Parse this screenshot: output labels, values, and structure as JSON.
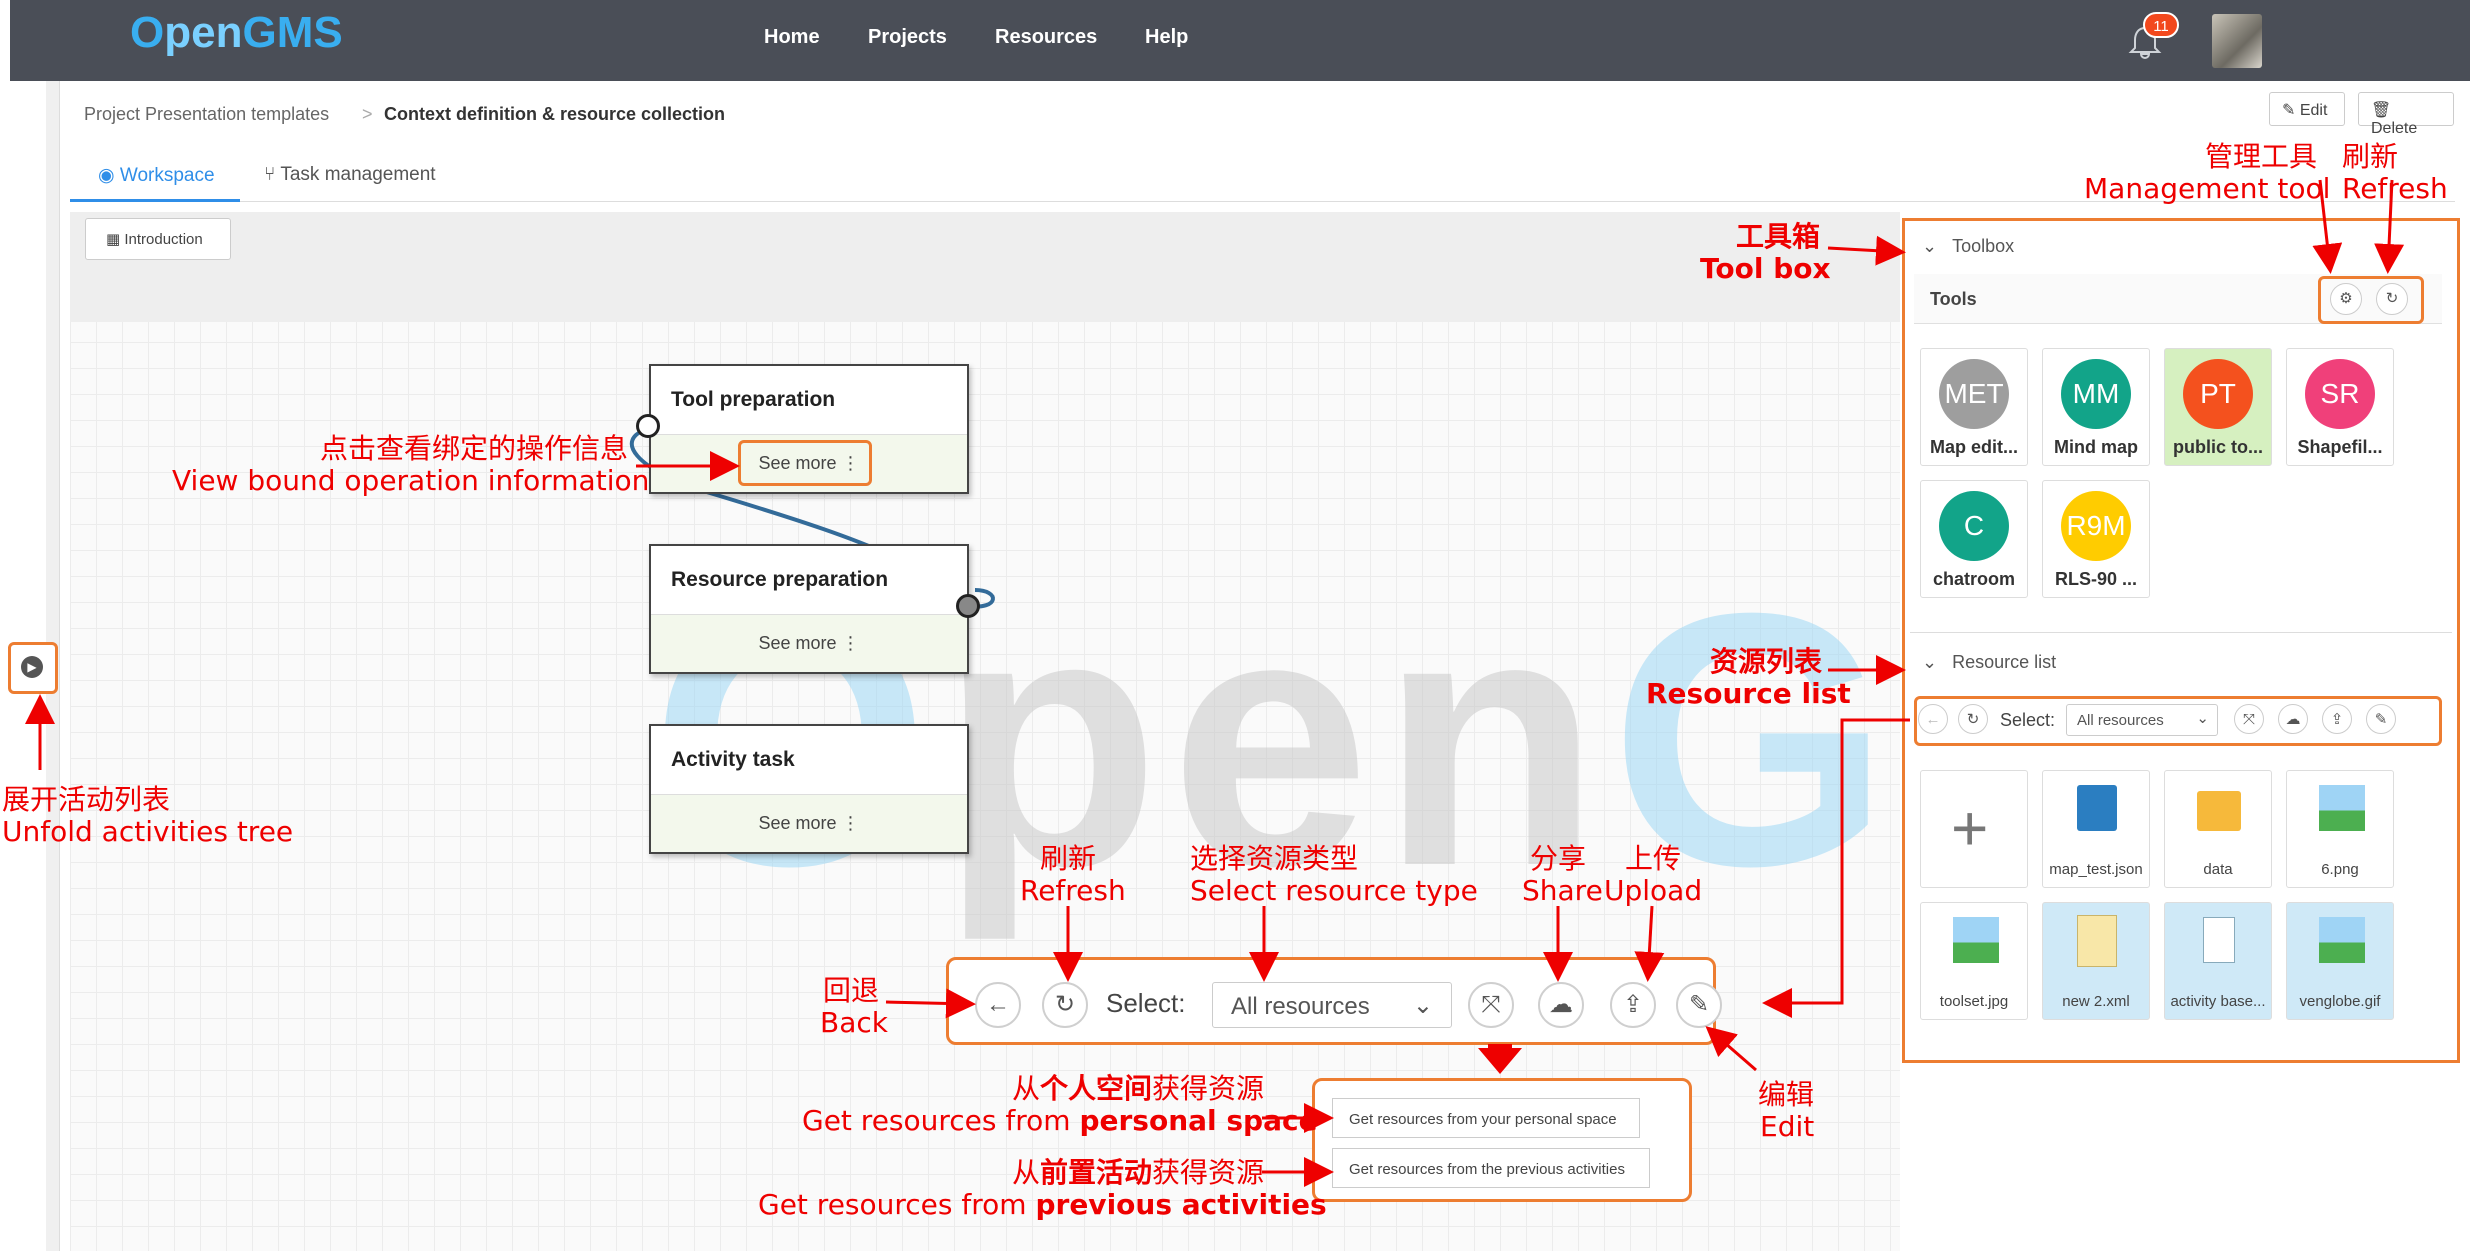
{
  "nav": {
    "logo_o": "O",
    "logo_pen": "pen",
    "logo_gms": "GMS",
    "links": [
      "Home",
      "Projects",
      "Resources",
      "Help"
    ],
    "notification_count": "11"
  },
  "breadcrumb": {
    "parent": "Project Presentation templates",
    "separator": ">",
    "current": "Context definition & resource collection"
  },
  "actions": {
    "edit": "Edit",
    "delete": "Delete"
  },
  "tabs": {
    "workspace": "Workspace",
    "task": "Task management"
  },
  "intro_button": "Introduction",
  "watermark": {
    "o": "O",
    "pen": "pen",
    "gms": "GMS"
  },
  "activities": [
    {
      "title": "Tool preparation",
      "more": "See more"
    },
    {
      "title": "Resource preparation",
      "more": "See more"
    },
    {
      "title": "Activity task",
      "more": "See more"
    }
  ],
  "toolbox": {
    "title": "Toolbox",
    "tools_label": "Tools",
    "tools": [
      {
        "abbr": "MET",
        "name": "Map edit...",
        "color": "#9e9e9e"
      },
      {
        "abbr": "MM",
        "name": "Mind map",
        "color": "#12a489"
      },
      {
        "abbr": "PT",
        "name": "public to...",
        "color": "#f4511e"
      },
      {
        "abbr": "SR",
        "name": "Shapefil...",
        "color": "#f0407a"
      },
      {
        "abbr": "C",
        "name": "chatroom",
        "color": "#12a489"
      },
      {
        "abbr": "R9M",
        "name": "RLS-90 ...",
        "color": "#ffcc00"
      }
    ]
  },
  "resource_list": {
    "title": "Resource list",
    "select_label": "Select:",
    "select_value": "All resources",
    "items": [
      {
        "name": "",
        "type": "add"
      },
      {
        "name": "map_test.json",
        "type": "json"
      },
      {
        "name": "data",
        "type": "folder"
      },
      {
        "name": "6.png",
        "type": "image"
      },
      {
        "name": "toolset.jpg",
        "type": "image"
      },
      {
        "name": "new 2.xml",
        "type": "xml"
      },
      {
        "name": "activity base...",
        "type": "doc"
      },
      {
        "name": "venglobe.gif",
        "type": "image"
      }
    ]
  },
  "big_toolbar": {
    "select_label": "Select:",
    "select_value": "All resources"
  },
  "dropdown": {
    "personal": "Get resources from your personal space",
    "previous": "Get resources from the previous activities"
  },
  "annotations": {
    "management_zh": "管理工具",
    "management_en": "Management tool",
    "refresh_zh": "刷新",
    "refresh_en": "Refresh",
    "toolbox_zh": "工具箱",
    "toolbox_en": "Tool box",
    "resource_zh": "资源列表",
    "resource_en": "Resource list",
    "view_zh": "点击查看绑定的操作信息",
    "view_en": "View bound operation information",
    "unfold_zh": "展开活动列表",
    "unfold_en": "Unfold activities tree",
    "back_zh": "回退",
    "back_en": "Back",
    "refresh2_zh": "刷新",
    "refresh2_en": "Refresh",
    "select_zh": "选择资源类型",
    "select_en": "Select resource type",
    "share_zh": "分享",
    "share_en": "Share",
    "upload_zh": "上传",
    "upload_en": "Upload",
    "edit_zh": "编辑",
    "edit_en": "Edit",
    "personal_zh_a": "从",
    "personal_zh_b": "个人空间",
    "personal_zh_c": "获得资源",
    "personal_en_a": "Get resources from ",
    "personal_en_b": "personal space",
    "previous_zh_a": "从",
    "previous_zh_b": "前置活动",
    "previous_zh_c": "获得资源",
    "previous_en_a": "Get resources from ",
    "previous_en_b": "previous activities"
  }
}
